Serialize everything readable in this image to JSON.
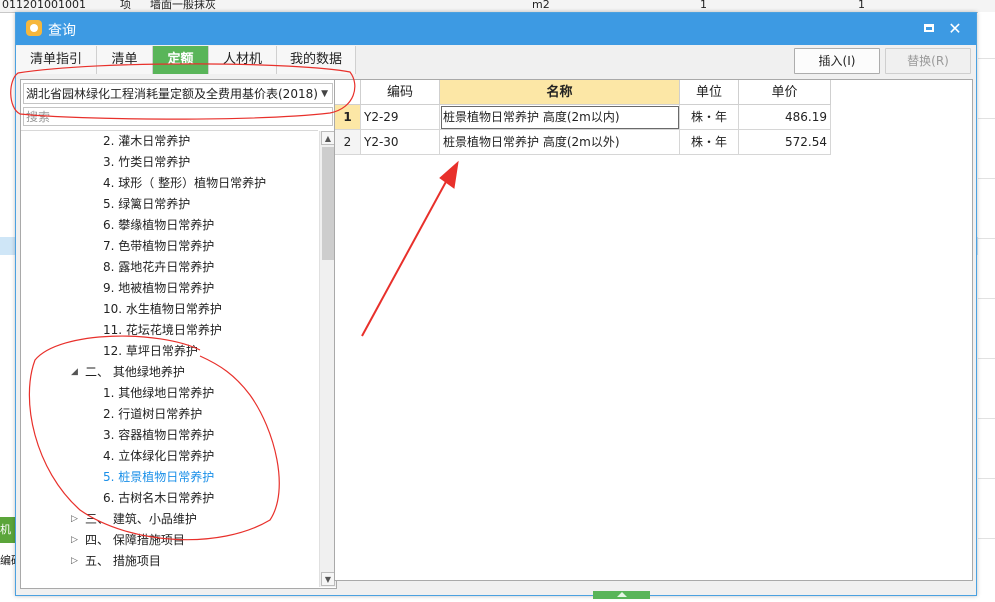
{
  "background": {
    "top_row": [
      "011201001001",
      "项",
      "墙面一般抹灰",
      "m2",
      "1",
      "1"
    ],
    "left_labels": [
      "机",
      "编码"
    ]
  },
  "dialog": {
    "title": "查询",
    "tabs": [
      "清单指引",
      "清单",
      "定额",
      "人材机",
      "我的数据"
    ],
    "active_tab": "定额",
    "insert_button": "插入(I)",
    "replace_button": "替换(R)"
  },
  "left": {
    "library": "湖北省园林绿化工程消耗量定额及全费用基价表(2018)",
    "search_placeholder": "搜索",
    "tree": [
      {
        "label": "2.  灌木日常养护",
        "level": 2
      },
      {
        "label": "3.  竹类日常养护",
        "level": 2
      },
      {
        "label": "4.  球形（ 整形）植物日常养护",
        "level": 2
      },
      {
        "label": "5.  绿篱日常养护",
        "level": 2
      },
      {
        "label": "6.  攀缘植物日常养护",
        "level": 2
      },
      {
        "label": "7.  色带植物日常养护",
        "level": 2
      },
      {
        "label": "8.  露地花卉日常养护",
        "level": 2
      },
      {
        "label": "9.  地被植物日常养护",
        "level": 2
      },
      {
        "label": "10.  水生植物日常养护",
        "level": 2
      },
      {
        "label": "11.  花坛花境日常养护",
        "level": 2
      },
      {
        "label": "12.  草坪日常养护",
        "level": 2
      },
      {
        "label": "二、  其他绿地养护",
        "level": 1,
        "expanded": true
      },
      {
        "label": "1.  其他绿地日常养护",
        "level": 2
      },
      {
        "label": "2.  行道树日常养护",
        "level": 2
      },
      {
        "label": "3.  容器植物日常养护",
        "level": 2
      },
      {
        "label": "4.  立体绿化日常养护",
        "level": 2
      },
      {
        "label": "5.  桩景植物日常养护",
        "level": 2,
        "selected": true
      },
      {
        "label": "6.  古树名木日常养护",
        "level": 2
      },
      {
        "label": "三、  建筑、小品维护",
        "level": 1,
        "expanded": false
      },
      {
        "label": "四、  保障措施项目",
        "level": 1,
        "expanded": false
      },
      {
        "label": "五、  措施项目",
        "level": 1,
        "expanded": false
      }
    ]
  },
  "table": {
    "columns": [
      "编码",
      "名称",
      "单位",
      "单价"
    ],
    "rows": [
      {
        "index": "1",
        "code": "Y2-29",
        "name": "桩景植物日常养护 高度(2m以内)",
        "unit": "株・年",
        "price": "486.19"
      },
      {
        "index": "2",
        "code": "Y2-30",
        "name": "桩景植物日常养护 高度(2m以外)",
        "unit": "株・年",
        "price": "572.54"
      }
    ]
  },
  "colors": {
    "titlebar": "#3d9ae3",
    "active_tab": "#59b559",
    "header_highlight": "#fce7a6",
    "selected_tree_item": "#1a8fe8",
    "annotation": "#e8302b"
  }
}
